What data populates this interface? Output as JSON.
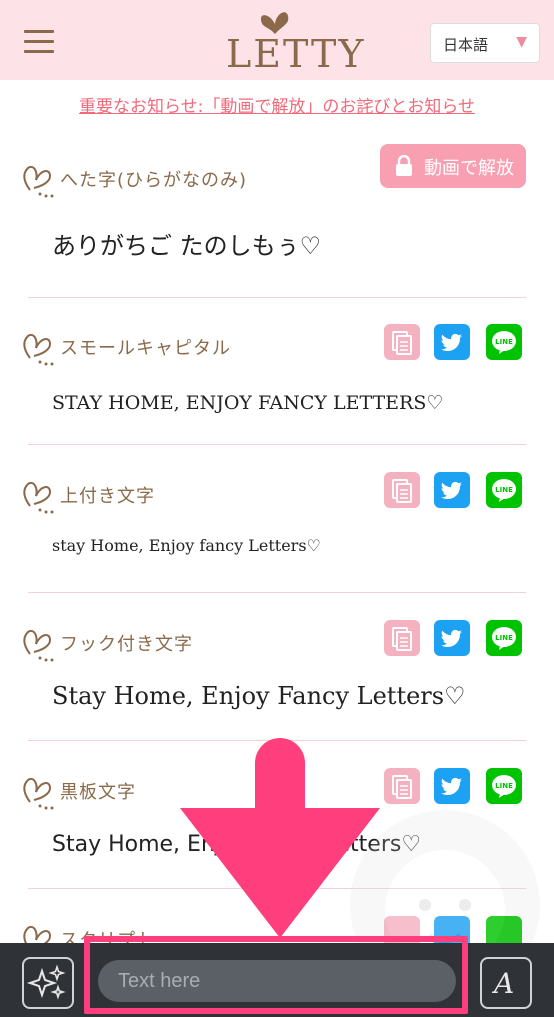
{
  "header": {
    "logo_text": "LETTY",
    "language": "日本語"
  },
  "notice": "重要なお知らせ:「動画で解放」のお詫びとお知らせ",
  "items": [
    {
      "title": "へた字(ひらがなのみ)",
      "sample": "ありがちご たのしもぅ♡",
      "locked": true,
      "unlock_label": "動画で解放"
    },
    {
      "title": "スモールキャピタル",
      "sample": "STAY HOME, ENJOY FANCY LETTERS♡"
    },
    {
      "title": "上付き文字",
      "sample": "stay Home, Enjoy fancy Letters♡"
    },
    {
      "title": "フック付き文字",
      "sample": "Stay Home, Enjoy Fancy Letters♡"
    },
    {
      "title": "黒板文字",
      "sample": "Stay Home, Enjoy Fancy Letters♡"
    },
    {
      "title": "スクリプト"
    }
  ],
  "actions": {
    "copy_icon": "copy-icon",
    "twitter_icon": "twitter-icon",
    "line_icon": "line-icon",
    "line_label": "LINE"
  },
  "bottom_bar": {
    "input_placeholder": "Text here",
    "font_button_glyph": "A"
  },
  "colors": {
    "header_bg": "#fde3e8",
    "accent_pink": "#f06a7a",
    "brown": "#8a6a4a",
    "twitter": "#1da1f2",
    "line": "#00c300",
    "overlay": "#ff3f7d"
  }
}
